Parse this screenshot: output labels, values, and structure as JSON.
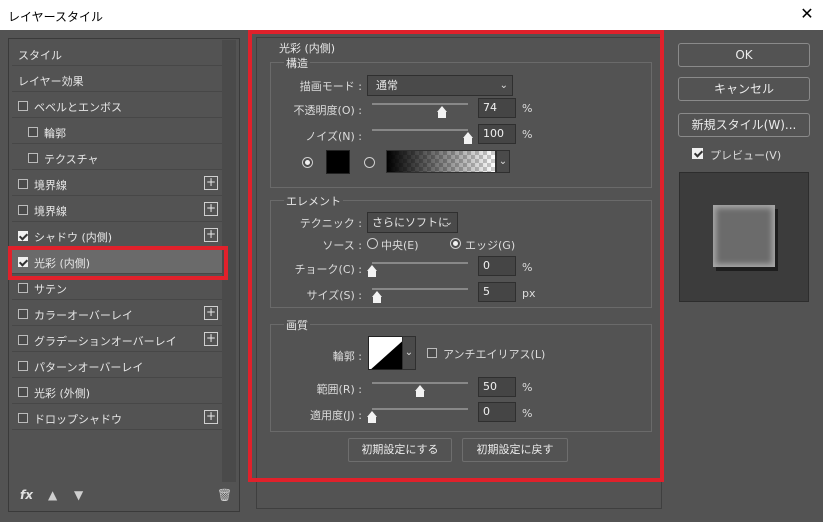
{
  "window": {
    "title": "レイヤースタイル",
    "close_icon": "close-icon"
  },
  "left_panel": {
    "items": [
      {
        "label": "スタイル",
        "checkbox": false,
        "checked": false,
        "plus": false
      },
      {
        "label": "レイヤー効果",
        "checkbox": false,
        "checked": false,
        "plus": false
      },
      {
        "label": "ベベルとエンボス",
        "checkbox": true,
        "checked": false,
        "plus": false
      },
      {
        "label": "輪郭",
        "checkbox": true,
        "checked": false,
        "plus": false,
        "indent": true
      },
      {
        "label": "テクスチャ",
        "checkbox": true,
        "checked": false,
        "plus": false,
        "indent": true
      },
      {
        "label": "境界線",
        "checkbox": true,
        "checked": false,
        "plus": true
      },
      {
        "label": "境界線",
        "checkbox": true,
        "checked": false,
        "plus": true
      },
      {
        "label": "シャドウ (内側)",
        "checkbox": true,
        "checked": true,
        "plus": true
      },
      {
        "label": "光彩 (内側)",
        "checkbox": true,
        "checked": true,
        "plus": false,
        "selected": true
      },
      {
        "label": "サテン",
        "checkbox": true,
        "checked": false,
        "plus": false
      },
      {
        "label": "カラーオーバーレイ",
        "checkbox": true,
        "checked": false,
        "plus": true
      },
      {
        "label": "グラデーションオーバーレイ",
        "checkbox": true,
        "checked": false,
        "plus": true
      },
      {
        "label": "パターンオーバーレイ",
        "checkbox": true,
        "checked": false,
        "plus": false
      },
      {
        "label": "光彩 (外側)",
        "checkbox": true,
        "checked": false,
        "plus": false
      },
      {
        "label": "ドロップシャドウ",
        "checkbox": true,
        "checked": false,
        "plus": true
      }
    ],
    "footer": {
      "fx": "fx",
      "up_icon": "arrow-up-icon",
      "down_icon": "arrow-down-icon",
      "trash_icon": "trash-icon"
    }
  },
  "main": {
    "section_title": "光彩 (内側)",
    "structure": {
      "legend": "構造",
      "blend_mode_label": "描画モード :",
      "blend_mode_value": "通常",
      "opacity_label": "不透明度(O) :",
      "opacity_value": "74",
      "opacity_unit": "%",
      "noise_label": "ノイズ(N) :",
      "noise_value": "100",
      "noise_unit": "%",
      "color_mode": "solid"
    },
    "element": {
      "legend": "エレメント",
      "technique_label": "テクニック :",
      "technique_value": "さらにソフトに",
      "source_label": "ソース :",
      "source_center": "中央(E)",
      "source_edge": "エッジ(G)",
      "source_selected": "edge",
      "choke_label": "チョーク(C) :",
      "choke_value": "0",
      "choke_unit": "%",
      "size_label": "サイズ(S) :",
      "size_value": "5",
      "size_unit": "px"
    },
    "quality": {
      "legend": "画質",
      "contour_label": "輪郭 :",
      "antialias_label": "アンチエイリアス(L)",
      "antialias_checked": false,
      "range_label": "範囲(R) :",
      "range_value": "50",
      "range_unit": "%",
      "jitter_label": "適用度(J) :",
      "jitter_value": "0",
      "jitter_unit": "%"
    },
    "buttons": {
      "make_default": "初期設定にする",
      "reset_default": "初期設定に戻す"
    }
  },
  "right_panel": {
    "ok": "OK",
    "cancel": "キャンセル",
    "new_style": "新規スタイル(W)...",
    "preview_label": "プレビュー(V)",
    "preview_checked": true
  },
  "colors": {
    "highlight_red": "#e0212b",
    "panel_bg": "#535353",
    "titlebar_bg": "#ffffff"
  }
}
